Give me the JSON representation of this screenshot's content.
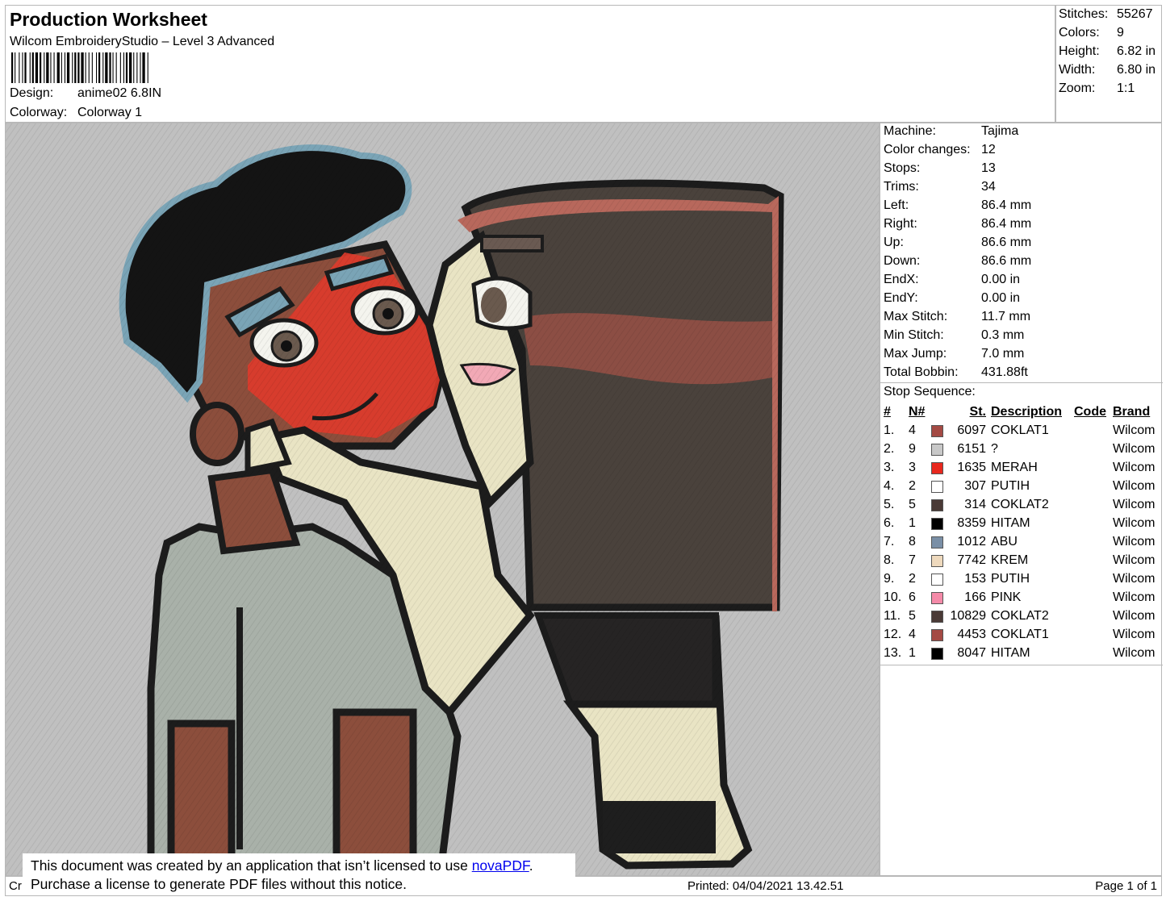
{
  "header": {
    "title": "Production Worksheet",
    "software": "Wilcom EmbroideryStudio – Level 3 Advanced",
    "design_label": "Design:",
    "design_value": "anime02 6.8IN",
    "colorway_label": "Colorway:",
    "colorway_value": "Colorway 1"
  },
  "summary": [
    {
      "label": "Stitches:",
      "value": "55267"
    },
    {
      "label": "Colors:",
      "value": "9"
    },
    {
      "label": "Height:",
      "value": "6.82 in"
    },
    {
      "label": "Width:",
      "value": "6.80 in"
    },
    {
      "label": "Zoom:",
      "value": "1:1"
    }
  ],
  "machine_info": [
    {
      "label": "Machine:",
      "value": "Tajima"
    },
    {
      "label": "Color changes:",
      "value": "12"
    },
    {
      "label": "Stops:",
      "value": "13"
    },
    {
      "label": "Trims:",
      "value": "34"
    },
    {
      "label": "Left:",
      "value": "86.4 mm"
    },
    {
      "label": "Right:",
      "value": "86.4 mm"
    },
    {
      "label": "Up:",
      "value": "86.6 mm"
    },
    {
      "label": "Down:",
      "value": "86.6 mm"
    },
    {
      "label": "EndX:",
      "value": "0.00 in"
    },
    {
      "label": "EndY:",
      "value": "0.00 in"
    },
    {
      "label": "Max Stitch:",
      "value": "11.7 mm"
    },
    {
      "label": "Min Stitch:",
      "value": "0.3 mm"
    },
    {
      "label": "Max Jump:",
      "value": "7.0 mm"
    },
    {
      "label": "Total Bobbin:",
      "value": "431.88ft"
    }
  ],
  "stop_sequence": {
    "title": "Stop Sequence:",
    "headers": {
      "num": "#",
      "n": "N#",
      "st": "St.",
      "desc": "Description",
      "code": "Code",
      "brand": "Brand"
    },
    "rows": [
      {
        "num": "1.",
        "n": "4",
        "color": "#a44a44",
        "st": "6097",
        "desc": "COKLAT1",
        "code": "",
        "brand": "Wilcom"
      },
      {
        "num": "2.",
        "n": "9",
        "color": "#c8c8c8",
        "st": "6151",
        "desc": "?",
        "code": "",
        "brand": "Wilcom"
      },
      {
        "num": "3.",
        "n": "3",
        "color": "#e8281e",
        "st": "1635",
        "desc": "MERAH",
        "code": "",
        "brand": "Wilcom"
      },
      {
        "num": "4.",
        "n": "2",
        "color": "#ffffff",
        "st": "307",
        "desc": "PUTIH",
        "code": "",
        "brand": "Wilcom"
      },
      {
        "num": "5.",
        "n": "5",
        "color": "#4a3a36",
        "st": "314",
        "desc": "COKLAT2",
        "code": "",
        "brand": "Wilcom"
      },
      {
        "num": "6.",
        "n": "1",
        "color": "#000000",
        "st": "8359",
        "desc": "HITAM",
        "code": "",
        "brand": "Wilcom"
      },
      {
        "num": "7.",
        "n": "8",
        "color": "#7a8fa6",
        "st": "1012",
        "desc": "ABU",
        "code": "",
        "brand": "Wilcom"
      },
      {
        "num": "8.",
        "n": "7",
        "color": "#eed9bd",
        "st": "7742",
        "desc": "KREM",
        "code": "",
        "brand": "Wilcom"
      },
      {
        "num": "9.",
        "n": "2",
        "color": "#ffffff",
        "st": "153",
        "desc": "PUTIH",
        "code": "",
        "brand": "Wilcom"
      },
      {
        "num": "10.",
        "n": "6",
        "color": "#f48aa8",
        "st": "166",
        "desc": "PINK",
        "code": "",
        "brand": "Wilcom"
      },
      {
        "num": "11.",
        "n": "5",
        "color": "#4a3a36",
        "st": "10829",
        "desc": "COKLAT2",
        "code": "",
        "brand": "Wilcom"
      },
      {
        "num": "12.",
        "n": "4",
        "color": "#a44a44",
        "st": "4453",
        "desc": "COKLAT1",
        "code": "",
        "brand": "Wilcom"
      },
      {
        "num": "13.",
        "n": "1",
        "color": "#000000",
        "st": "8047",
        "desc": "HITAM",
        "code": "",
        "brand": "Wilcom"
      }
    ]
  },
  "footer": {
    "left_text": "Cr",
    "printed": "Printed: 04/04/2021 13.42.51",
    "page": "Page 1 of 1"
  },
  "notice": {
    "line1_prefix": "This document was created by an application that isn’t licensed to use ",
    "line1_link": "novaPDF",
    "line1_suffix": ".",
    "line2": "Purchase a license to generate PDF files without this notice."
  }
}
